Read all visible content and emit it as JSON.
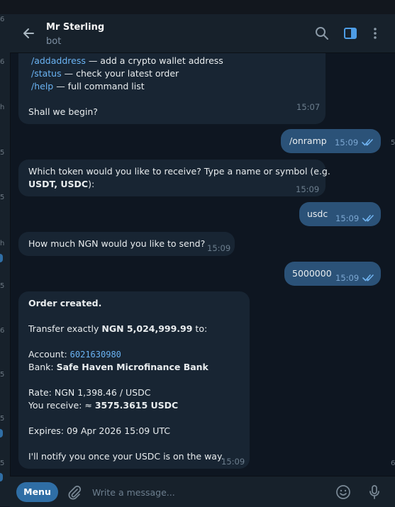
{
  "header": {
    "title": "Mr Sterling",
    "subtitle": "bot"
  },
  "sidebar_hints": [
    "6",
    "6",
    "h",
    "5",
    "5",
    "h",
    "5",
    "6",
    "5",
    "5",
    "5",
    "5",
    "6"
  ],
  "messages": {
    "m1": {
      "lines": [
        {
          "cmd": "/addaddress",
          "desc": " — add a crypto wallet address"
        },
        {
          "cmd": "/status",
          "desc": " — check your latest order"
        },
        {
          "cmd": "/help",
          "desc": " — full command list"
        }
      ],
      "closing": "Shall we begin?",
      "time": "15:07"
    },
    "m2": {
      "text": "/onramp",
      "time": "15:09"
    },
    "m3": {
      "line1": "Which token would you like to receive? Type a name or symbol (e.g.",
      "line2_bold": "USDT, USDC",
      "line2_rest": "):",
      "time": "15:09"
    },
    "m4": {
      "text": "usdc",
      "time": "15:09"
    },
    "m5": {
      "text": "How much NGN would you like to send?",
      "time": "15:09"
    },
    "m6": {
      "text": "5000000",
      "time": "15:09"
    },
    "m7": {
      "heading": "Order created.",
      "transfer_prefix": "Transfer exactly ",
      "transfer_amount": "NGN 5,024,999.99",
      "transfer_suffix": " to:",
      "account_label": "Account: ",
      "account_number": "6021630980",
      "bank_label": "Bank: ",
      "bank_name": "Safe Haven Microfinance Bank",
      "rate": "Rate: NGN 1,398.46 / USDC",
      "receive_label": "You receive: ≈ ",
      "receive_amount": "3575.3615 USDC",
      "expires": "Expires: 09 Apr 2026 15:09 UTC",
      "notify": "I'll notify you once your USDC is on the way.",
      "time": "15:09"
    }
  },
  "composer": {
    "menu_label": "Menu",
    "placeholder": "Write a message..."
  },
  "colors": {
    "background": "#0e1621",
    "incoming": "#182533",
    "outgoing": "#2b5278",
    "accent": "#6ab3f3",
    "button": "#2f6ea5"
  },
  "icons": [
    "back-arrow-icon",
    "search-icon",
    "sidebar-toggle-icon",
    "more-vert-icon",
    "paperclip-icon",
    "emoji-icon",
    "microphone-icon",
    "double-check-icon"
  ]
}
